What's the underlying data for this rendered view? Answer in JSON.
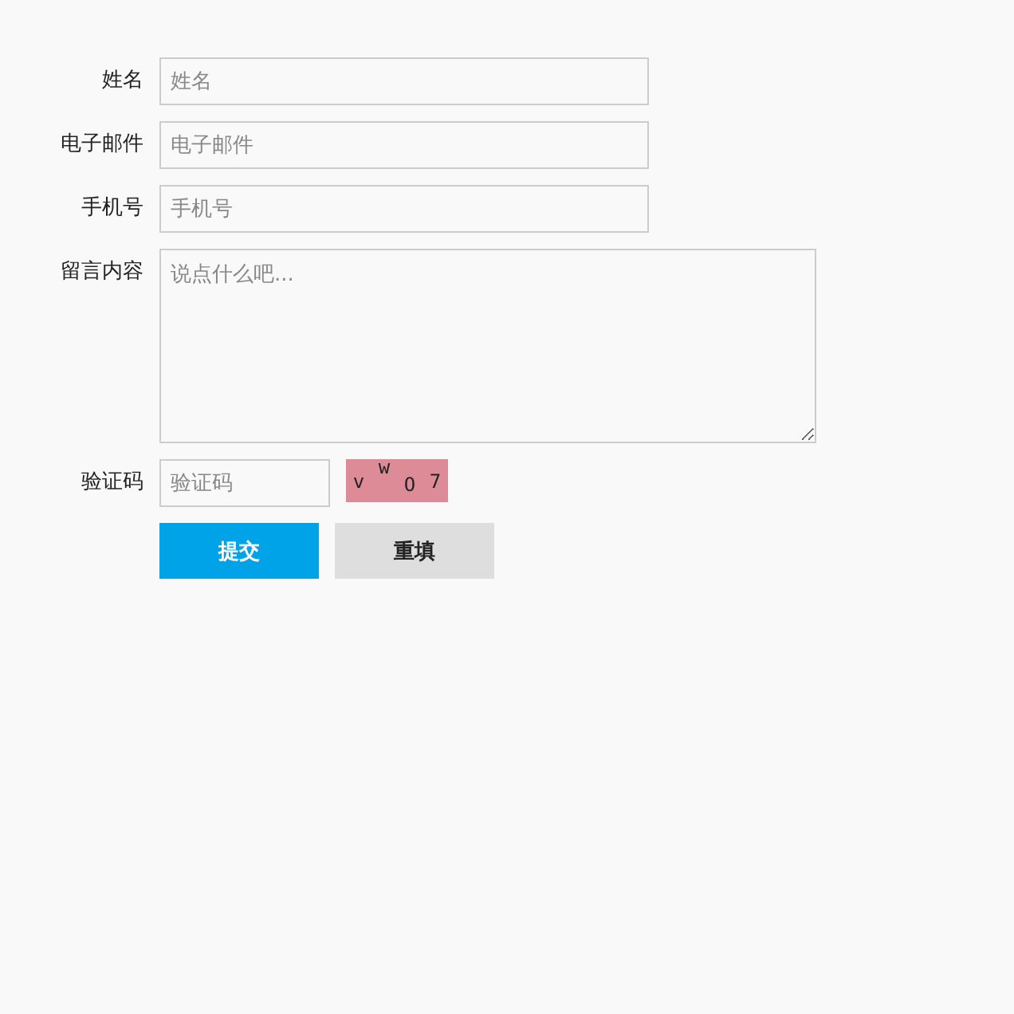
{
  "fields": [
    {
      "label": "姓名",
      "placeholder": "姓名",
      "kind": "input"
    },
    {
      "label": "电子邮件",
      "placeholder": "电子邮件",
      "kind": "input"
    },
    {
      "label": "手机号",
      "placeholder": "手机号",
      "kind": "input"
    },
    {
      "label": "留言内容",
      "placeholder": "说点什么吧...",
      "kind": "textarea"
    }
  ],
  "captcha": {
    "label": "验证码",
    "placeholder": "验证码",
    "chars": [
      "v",
      "w",
      "O",
      "7"
    ]
  },
  "buttons": [
    {
      "label": "提交",
      "kind": "primary"
    },
    {
      "label": "重填",
      "kind": "secondary"
    }
  ]
}
